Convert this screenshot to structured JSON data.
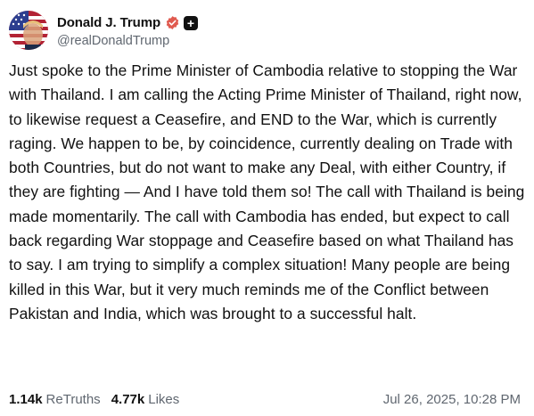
{
  "author": {
    "display_name": "Donald J. Trump",
    "handle": "@realDonaldTrump",
    "avatar_icon": "profile-avatar-flag",
    "verified_icon": "verified-badge-icon",
    "verified_color": "#e05a4f",
    "extra_badge_icon": "plus-badge-icon",
    "extra_badge_symbol": "+"
  },
  "post": {
    "text": "Just spoke to the Prime Minister of Cambodia relative to stopping the War with Thailand. I am calling the Acting Prime Minister of Thailand, right now, to likewise request a Ceasefire, and END to the War, which is currently raging. We happen to be, by coincidence, currently dealing on Trade with both Countries, but do not want to make any Deal, with either Country, if they are fighting — And I have told them so! The call with Thailand is being made momentarily. The call with Cambodia has ended, but expect to call back regarding War stoppage and Ceasefire based on what Thailand has to say. I am trying to simplify a complex situation! Many people are being killed in this War, but it very much reminds me of the Conflict between Pakistan and India, which was brought to a successful halt."
  },
  "stats": {
    "retruths_count": "1.14k",
    "retruths_label": "ReTruths",
    "likes_count": "4.77k",
    "likes_label": "Likes"
  },
  "timestamp": "Jul 26, 2025, 10:28 PM"
}
